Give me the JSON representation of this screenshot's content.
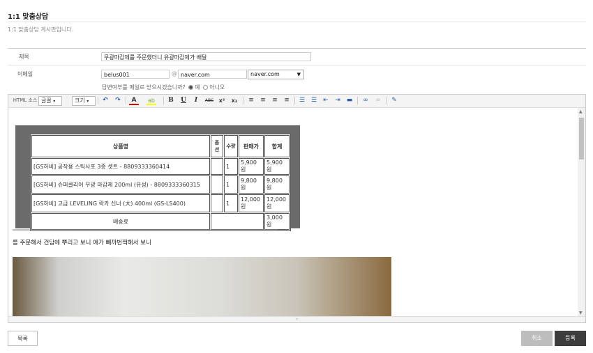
{
  "page": {
    "title": "1:1 맞춤상담",
    "description": "1:1 맞춤상담 게시판입니다."
  },
  "form": {
    "subject_label": "제목",
    "subject_value": "무광마감제를 주문했더니 유광마감제가 배달",
    "email_label": "이메일",
    "email_id": "belus001",
    "at_sign": "@",
    "email_domain": "naver.com",
    "domain_select": "naver.com",
    "reply_question": "답변여부를 메일로 받으시겠습니까?",
    "reply_yes": "예",
    "reply_no": "아니오"
  },
  "toolbar": {
    "source": "HTML 소스",
    "font": "글꼴",
    "size": "크기",
    "undo": "↶",
    "redo": "↷",
    "font_color": "A",
    "highlight": "ab",
    "bold": "B",
    "underline": "U",
    "italic": "I",
    "strike": "ABC",
    "superscript": "x²",
    "subscript": "x₂"
  },
  "order_table": {
    "headers": [
      "상품명",
      "옵션",
      "수량",
      "판매가",
      "합계"
    ],
    "rows": [
      {
        "name": "[GS하비] 공작용 스틱사포 3종 셋트 - 8809333360414",
        "option": "",
        "qty": "1",
        "price": "5,900원",
        "total": "5,900원"
      },
      {
        "name": "[GS하비] 슈퍼클리어 무광 마감제 200ml (유성) - 8809333360315",
        "option": "",
        "qty": "1",
        "price": "9,800원",
        "total": "9,800원"
      },
      {
        "name": "[GS하비] 고급 LEVELING 락카 신너 (大) 400ml (GS-LS400)",
        "option": "",
        "qty": "1",
        "price": "12,000원",
        "total": "12,000원"
      }
    ],
    "shipping_label": "배송료",
    "shipping_value": "3,000원"
  },
  "body_text": "를 주문해서 건담에 뿌리고 보니 애가 빼까번쩍해서 보니",
  "buttons": {
    "list": "목록",
    "cancel": "취소",
    "submit": "등록"
  },
  "colors": {
    "submit_bg": "#3d3d3d",
    "cancel_bg": "#bdbdbd"
  }
}
